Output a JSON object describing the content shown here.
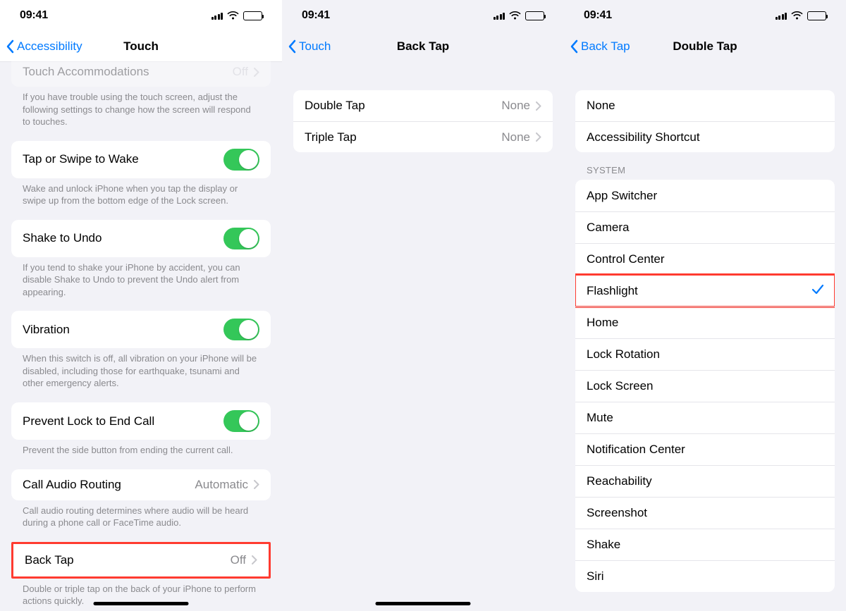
{
  "status": {
    "time": "09:41"
  },
  "screen1": {
    "nav": {
      "back": "Accessibility",
      "title": "Touch"
    },
    "cut_row": {
      "label": "Touch Accommodations",
      "value": "Off"
    },
    "cut_footer": "If you have trouble using the touch screen, adjust the following settings to change how the screen will respond to touches.",
    "items": [
      {
        "label": "Tap or Swipe to Wake",
        "toggle": true,
        "footer": "Wake and unlock iPhone when you tap the display or swipe up from the bottom edge of the Lock screen."
      },
      {
        "label": "Shake to Undo",
        "toggle": true,
        "footer": "If you tend to shake your iPhone by accident, you can disable Shake to Undo to prevent the Undo alert from appearing."
      },
      {
        "label": "Vibration",
        "toggle": true,
        "footer": "When this switch is off, all vibration on your iPhone will be disabled, including those for earthquake, tsunami and other emergency alerts."
      },
      {
        "label": "Prevent Lock to End Call",
        "toggle": true,
        "footer": "Prevent the side button from ending the current call."
      },
      {
        "label": "Call Audio Routing",
        "value": "Automatic",
        "footer": "Call audio routing determines where audio will be heard during a phone call or FaceTime audio."
      },
      {
        "label": "Back Tap",
        "value": "Off",
        "highlighted": true,
        "footer": "Double or triple tap on the back of your iPhone to perform actions quickly."
      }
    ]
  },
  "screen2": {
    "nav": {
      "back": "Touch",
      "title": "Back Tap"
    },
    "rows": [
      {
        "label": "Double Tap",
        "value": "None"
      },
      {
        "label": "Triple Tap",
        "value": "None"
      }
    ]
  },
  "screen3": {
    "nav": {
      "back": "Back Tap",
      "title": "Double Tap"
    },
    "top_rows": [
      {
        "label": "None"
      },
      {
        "label": "Accessibility Shortcut"
      }
    ],
    "system_header": "System",
    "system_rows": [
      {
        "label": "App Switcher"
      },
      {
        "label": "Camera"
      },
      {
        "label": "Control Center"
      },
      {
        "label": "Flashlight",
        "selected": true,
        "highlighted": true
      },
      {
        "label": "Home"
      },
      {
        "label": "Lock Rotation"
      },
      {
        "label": "Lock Screen"
      },
      {
        "label": "Mute"
      },
      {
        "label": "Notification Center"
      },
      {
        "label": "Reachability"
      },
      {
        "label": "Screenshot"
      },
      {
        "label": "Shake"
      },
      {
        "label": "Siri"
      }
    ]
  }
}
